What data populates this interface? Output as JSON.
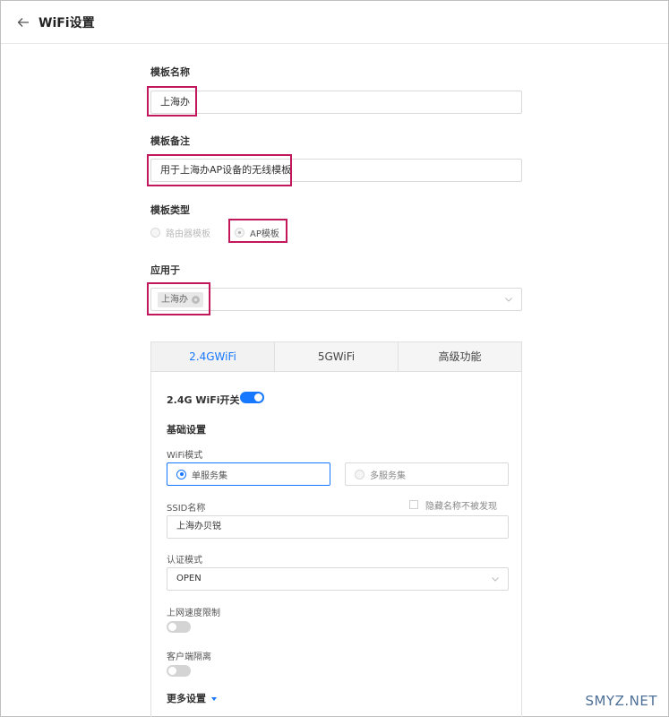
{
  "header": {
    "title": "WiFi设置"
  },
  "form": {
    "template_name_label": "模板名称",
    "template_name_value": "上海办",
    "template_note_label": "模板备注",
    "template_note_value": "用于上海办AP设备的无线模板",
    "template_type_label": "模板类型",
    "template_type_options": [
      "路由器模板",
      "AP模板"
    ],
    "apply_to_label": "应用于",
    "apply_to_tag": "上海办"
  },
  "tabs": [
    "2.4GWiFi",
    "5GWiFi",
    "高级功能"
  ],
  "panel": {
    "wifi_switch_label": "2.4G WiFi开关",
    "basic_settings_label": "基础设置",
    "wifi_mode_label": "WiFi模式",
    "wifi_mode_options": [
      "单服务集",
      "多服务集"
    ],
    "ssid_label": "SSID名称",
    "hide_ssid_label": "隐藏名称不被发现",
    "ssid_value": "上海办贝锐",
    "auth_label": "认证模式",
    "auth_value": "OPEN",
    "speed_limit_label": "上网速度限制",
    "client_isolation_label": "客户端隔离",
    "more_settings_label": "更多设置"
  },
  "watermark": "SMYZ.NET",
  "colors": {
    "accent": "#1677ff",
    "highlight": "#c2185b"
  }
}
